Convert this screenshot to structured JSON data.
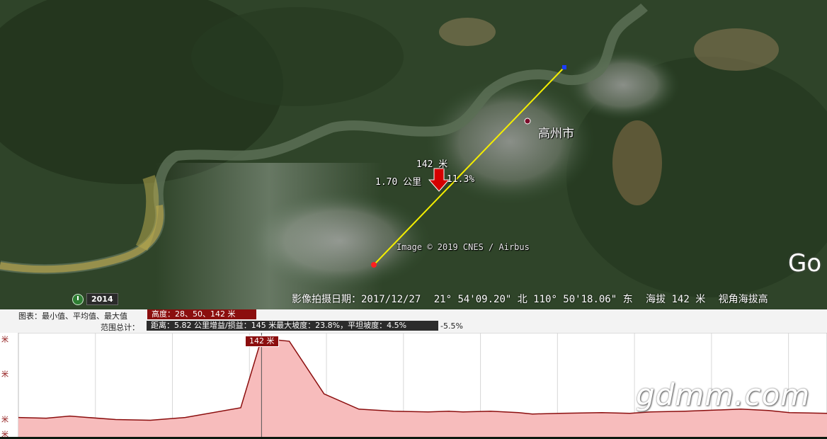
{
  "map": {
    "city_label": "高州市",
    "height_label": "142 米",
    "distance_label": "1.70 公里",
    "slope_label": "11.3%",
    "image_credit": "Image © 2019 CNES / Airbus",
    "google_mark": "Go",
    "year": "2014",
    "status": {
      "image_date": "影像拍摄日期：2017/12/27",
      "coordinates": "21° 54'09.20\" 北 110° 50'18.06\" 东",
      "altitude": "海拔    142 米",
      "view": "视角海拔高"
    },
    "colors": {
      "path": "#f4ee00",
      "start_marker": "#ff2020",
      "end_marker": "#1a3cff",
      "arrow": "#d40000"
    }
  },
  "profile": {
    "chart_label": "图表：最小值、平均值、最大值",
    "elevation_stats": "高度：28、50、142 米",
    "range_label": "范围总计：",
    "stats": "距离：5.82 公里增益/损益：145 米最大坡度：23.8%，平坦坡度：4.5%",
    "slope_max": "-5.5%",
    "marker_label": "142 米",
    "y_axis": [
      "米",
      "米",
      "米",
      "米"
    ],
    "watermark": "gdmm.com"
  },
  "chart_data": {
    "type": "area",
    "title": "",
    "xlabel": "",
    "ylabel": "米",
    "xlim": [
      0,
      5.82
    ],
    "ylim": [
      0,
      142
    ],
    "x": [
      0,
      0.2,
      0.37,
      0.5,
      0.7,
      0.95,
      1.2,
      1.6,
      1.75,
      1.95,
      2.2,
      2.45,
      2.7,
      2.95,
      3.1,
      3.2,
      3.4,
      3.6,
      3.7,
      3.9,
      4.2,
      4.4,
      4.55,
      4.8,
      5.2,
      5.4,
      5.55,
      5.82
    ],
    "y": [
      28,
      27,
      30,
      28,
      25,
      24,
      28,
      42,
      142,
      138,
      62,
      40,
      37,
      36,
      37,
      36,
      37,
      35,
      33,
      34,
      35,
      34,
      36,
      37,
      40,
      38,
      35,
      34
    ]
  }
}
